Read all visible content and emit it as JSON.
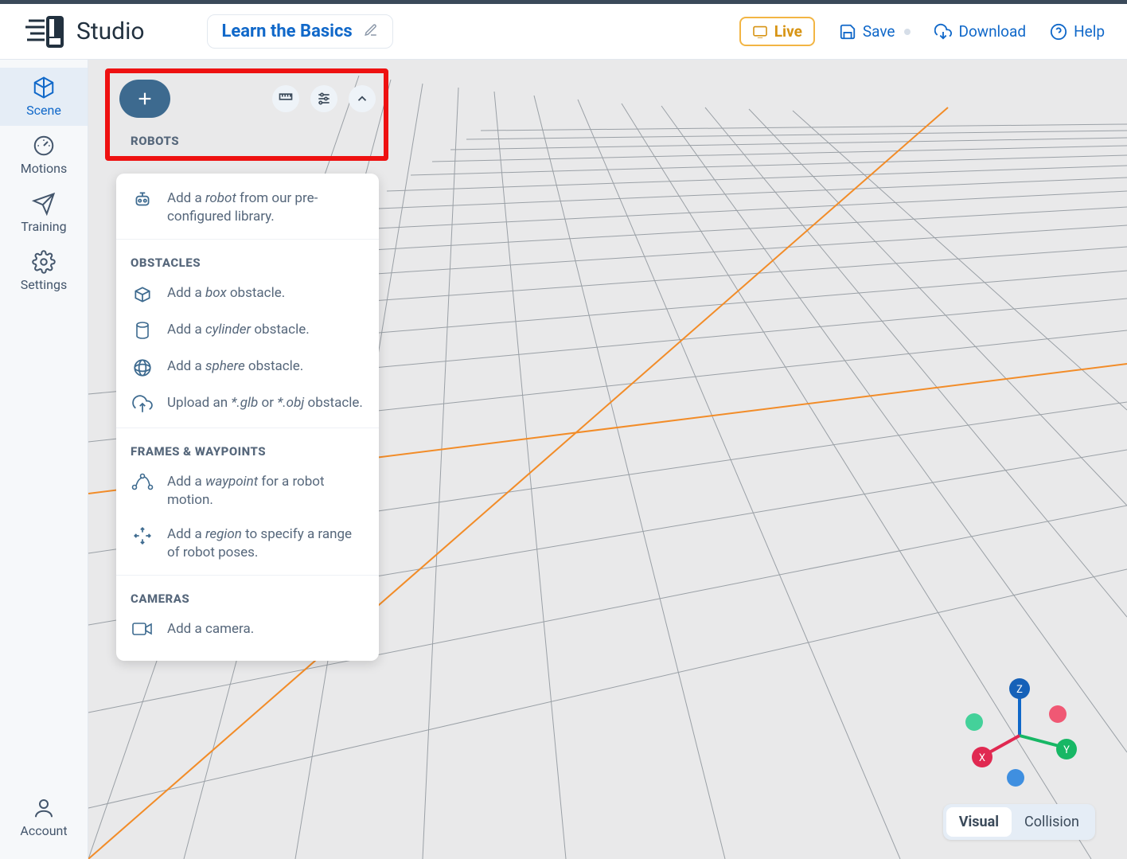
{
  "app": {
    "name": "Studio"
  },
  "title": "Learn the Basics",
  "top_actions": {
    "live": "Live",
    "save": "Save",
    "download": "Download",
    "help": "Help"
  },
  "rail": {
    "scene": "Scene",
    "motions": "Motions",
    "training": "Training",
    "settings": "Settings",
    "account": "Account"
  },
  "panel": {
    "sections": {
      "robots": {
        "title": "ROBOTS",
        "add_robot": "Add a robot from our pre-configured library."
      },
      "obstacles": {
        "title": "OBSTACLES",
        "box": "Add a box obstacle.",
        "cylinder": "Add a cylinder obstacle.",
        "sphere": "Add a sphere obstacle.",
        "upload": "Upload an *.glb or *.obj obstacle."
      },
      "frames": {
        "title": "FRAMES & WAYPOINTS",
        "waypoint": "Add a waypoint for a robot motion.",
        "region": "Add a region to specify a range of robot poses."
      },
      "cameras": {
        "title": "CAMERAS",
        "camera": "Add a camera."
      }
    }
  },
  "viz": {
    "visual": "Visual",
    "collision": "Collision"
  },
  "gizmo": {
    "x": "X",
    "y": "Y",
    "z": "Z"
  }
}
